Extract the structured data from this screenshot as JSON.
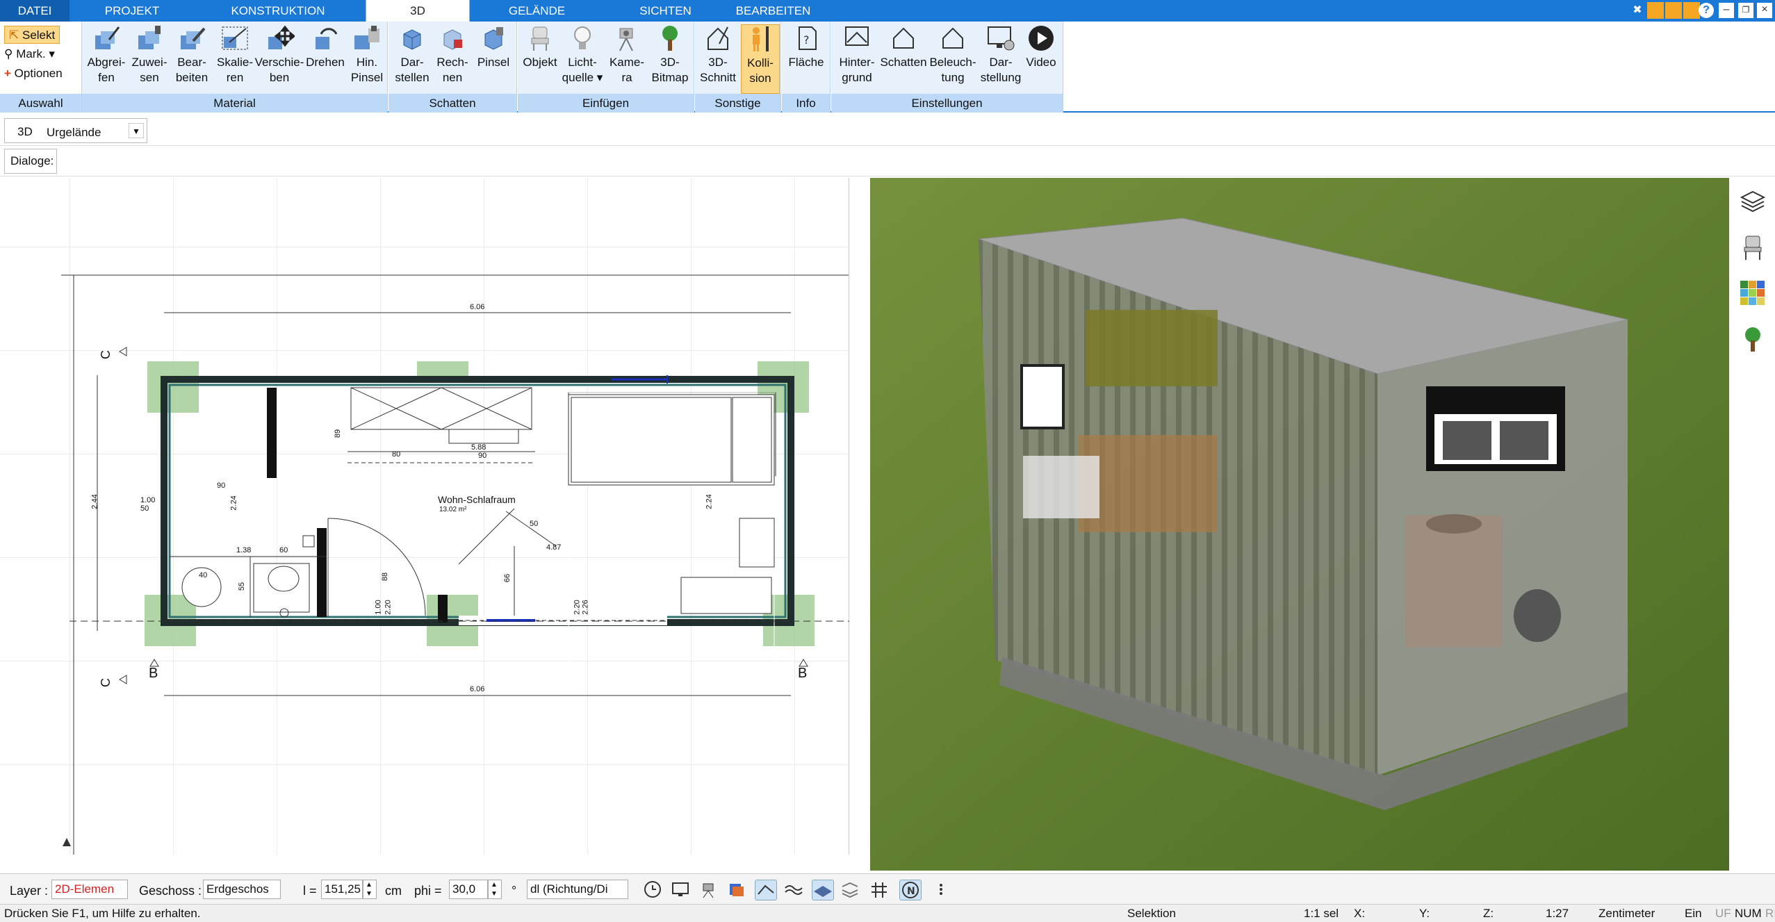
{
  "tabs": [
    "DATEI",
    "PROJEKT",
    "KONSTRUKTION",
    "3D",
    "GELÄNDE",
    "SICHTEN",
    "BEARBEITEN"
  ],
  "active_tab": "3D",
  "auswahl": {
    "selekt": "Selekt",
    "mark": "Mark.",
    "optionen": "Optionen",
    "label": "Auswahl"
  },
  "groups": {
    "material": "Material",
    "schatten": "Schatten",
    "einfuegen": "Einfügen",
    "sonstige": "Sonstige",
    "info": "Info",
    "einstellungen": "Einstellungen"
  },
  "buttons": {
    "abgreifen": "Abgrei-\nfen",
    "zuweisen": "Zuwei-\nsen",
    "bearbeiten": "Bear-\nbeiten",
    "skalieren": "Skalie-\nren",
    "verschieben": "Verschie-\nben",
    "drehen": "Drehen",
    "hinpinsel": "Hin.\nPinsel",
    "darstellen": "Dar-\nstellen",
    "rechnen": "Rech-\nnen",
    "pinsel": "Pinsel",
    "objekt": "Objekt",
    "lichtquelle": "Licht-\nquelle",
    "kamera": "Kame-\nra",
    "bitmap": "3D-\nBitmap",
    "schnitt": "3D-\nSchnitt",
    "kollision": "Kolli-\nsion",
    "flaeche": "Fläche",
    "hintergrund": "Hinter-\ngrund",
    "schatten": "Schatten",
    "beleuchtung": "Beleuch-\ntung",
    "darstellung": "Dar-\nstellung",
    "video": "Video"
  },
  "view_selector": {
    "mode": "3D",
    "value": "Urgelände"
  },
  "dialoge_label": "Dialoge:",
  "plan": {
    "room_name": "Wohn-Schlafraum",
    "room_area": "13.02 m²",
    "dim_top": "6.06",
    "dim_bottom": "6.06",
    "dim_left": "2.44",
    "dim_right": "2.24",
    "section_c": "C",
    "section_b": "B",
    "labels": [
      "1.00",
      "50",
      "90",
      "2.24",
      "40",
      "1.38",
      "60",
      "55",
      "66",
      "1.00",
      "2.20",
      "88",
      "2.20",
      "2.26",
      "4.87",
      "50",
      "80",
      "89",
      "5.88",
      "90"
    ]
  },
  "bottom": {
    "layer_label": "Layer :",
    "layer_value": "2D-Elemen",
    "geschoss_label": "Geschoss :",
    "geschoss_value": "Erdgeschos",
    "l_label": "l =",
    "l_value": "151,25",
    "l_unit": "cm",
    "phi_label": "phi =",
    "phi_value": "30,0",
    "phi_unit": "°",
    "dl_value": "dl (Richtung/Di"
  },
  "status": {
    "help": "Drücken Sie F1, um Hilfe zu erhalten.",
    "mode": "Selektion",
    "scale1": "1:1 sel",
    "x": "X:",
    "y": "Y:",
    "z": "Z:",
    "scale2": "1:27",
    "unit": "Zentimeter",
    "ein": "Ein",
    "uf": "UF",
    "num": "NUM",
    "ri": "RI"
  },
  "colors": {
    "accent": "#1a78d6",
    "ribbon_group": "#e6f1fc",
    "grass": "#5e7f2f",
    "active_btn": "#fbd88a"
  }
}
